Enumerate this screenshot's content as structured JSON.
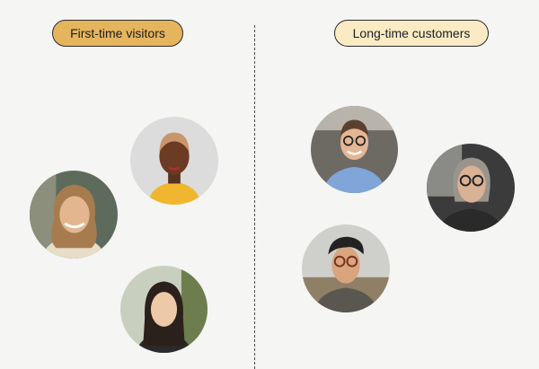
{
  "left_group": {
    "label": "First-time visitors"
  },
  "right_group": {
    "label": "Long-time customers"
  },
  "avatars": {
    "left": [
      "woman-short-hair-yellow-top",
      "man-long-hair-beard",
      "woman-long-dark-hair"
    ],
    "right": [
      "man-glasses-blue-shirt",
      "woman-glasses-grey-hair",
      "man-glasses-cap"
    ]
  }
}
